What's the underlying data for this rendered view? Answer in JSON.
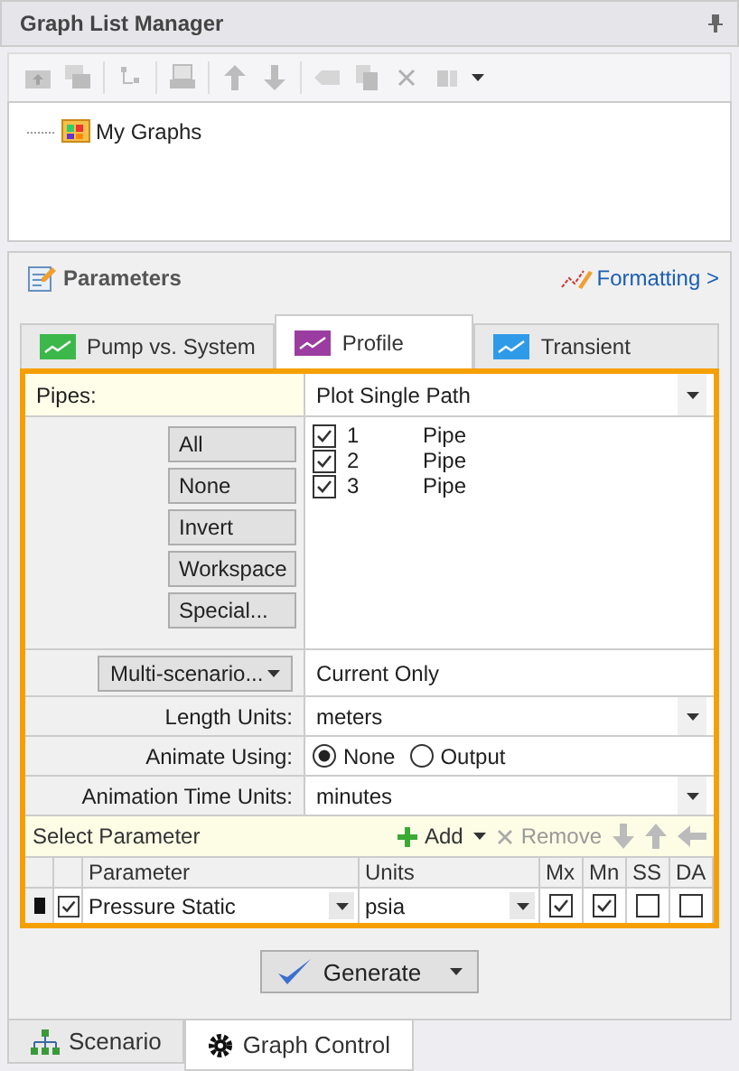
{
  "graph_list_manager": {
    "title": "Graph List Manager",
    "toolbar": [
      {
        "disabled": true
      },
      {
        "disabled": true
      },
      {
        "disabled": true
      },
      {
        "disabled": true
      },
      {
        "disabled": true
      },
      {
        "disabled": true
      },
      {
        "disabled": true
      },
      {
        "disabled": true
      },
      {
        "disabled": true
      },
      {
        "disabled": true
      }
    ],
    "tree": [
      {
        "label": "My Graphs"
      }
    ]
  },
  "parameters": {
    "title": "Parameters",
    "formatting_link": "Formatting >",
    "tabs": [
      {
        "label": "Pump vs. System",
        "selected": false,
        "color": "#3cb84a"
      },
      {
        "label": "Profile",
        "selected": true,
        "color": "#9b3ca0"
      },
      {
        "label": "Transient",
        "selected": false,
        "color": "#2f9be8"
      }
    ],
    "pipes": {
      "label": "Pipes:",
      "mode": "Plot Single Path",
      "buttons": [
        "All",
        "None",
        "Invert",
        "Workspace",
        "Special..."
      ],
      "items": [
        {
          "id": "1",
          "type": "Pipe",
          "checked": true
        },
        {
          "id": "2",
          "type": "Pipe",
          "checked": true
        },
        {
          "id": "3",
          "type": "Pipe",
          "checked": true
        }
      ]
    },
    "multi_scenario": {
      "button": "Multi-scenario...",
      "value": "Current Only"
    },
    "length_units": {
      "label": "Length Units:",
      "value": "meters"
    },
    "animate_using": {
      "label": "Animate Using:",
      "options": [
        {
          "label": "None",
          "selected": true
        },
        {
          "label": "Output",
          "selected": false
        }
      ]
    },
    "animation_time_units": {
      "label": "Animation Time Units:",
      "value": "minutes"
    },
    "select_parameter": {
      "title": "Select Parameter",
      "add": "Add",
      "remove": "Remove",
      "remove_disabled": true
    },
    "grid": {
      "columns": [
        "Parameter",
        "Units",
        "Mx",
        "Mn",
        "SS",
        "DA"
      ],
      "rows": [
        {
          "checked": true,
          "parameter": "Pressure Static",
          "units": "psia",
          "flags": [
            true,
            true,
            false,
            false
          ]
        }
      ]
    },
    "generate": "Generate"
  },
  "bottom_tabs": [
    {
      "label": "Scenario",
      "selected": false
    },
    {
      "label": "Graph Control",
      "selected": true
    }
  ]
}
